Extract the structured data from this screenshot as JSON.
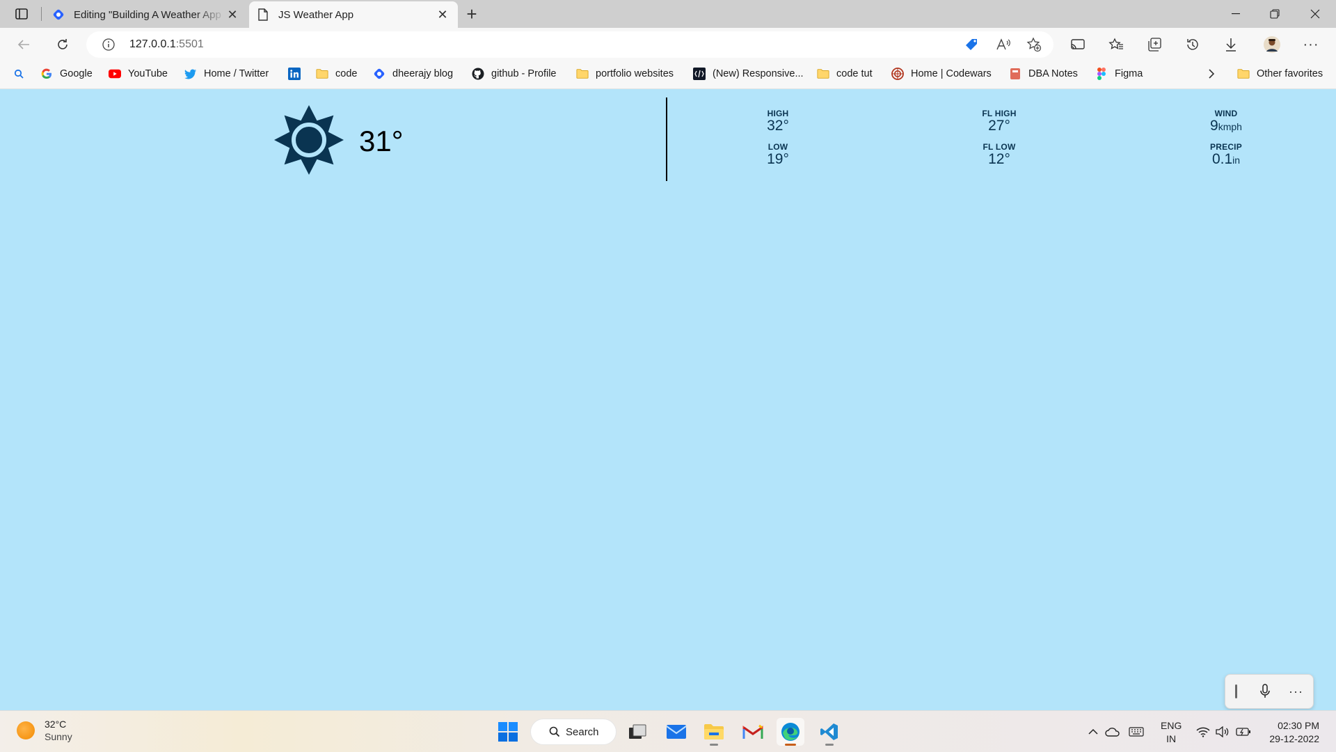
{
  "browser": {
    "tabs": [
      {
        "title": "Editing \"Building A Weather App",
        "favicon": "hashnode-icon"
      },
      {
        "title": "JS Weather App",
        "favicon": "page-icon"
      }
    ],
    "url": {
      "host": "127.0.0.1",
      "port": ":5501"
    }
  },
  "bookmarks": [
    {
      "label": "Google",
      "icon": "google-icon"
    },
    {
      "label": "YouTube",
      "icon": "youtube-icon"
    },
    {
      "label": "Home / Twitter",
      "icon": "twitter-icon"
    },
    {
      "label": "",
      "icon": "linkedin-icon"
    },
    {
      "label": "code",
      "icon": "folder-icon"
    },
    {
      "label": "dheerajy blog",
      "icon": "hashnode-icon"
    },
    {
      "label": "github - Profile",
      "icon": "github-icon"
    },
    {
      "label": "portfolio websites",
      "icon": "folder-icon"
    },
    {
      "label": "(New) Responsive...",
      "icon": "site-icon"
    },
    {
      "label": "code tut",
      "icon": "folder-icon"
    },
    {
      "label": "Home | Codewars",
      "icon": "codewars-icon"
    },
    {
      "label": "DBA Notes",
      "icon": "notes-icon"
    },
    {
      "label": "Figma",
      "icon": "figma-icon"
    },
    {
      "label": "Other favorites",
      "icon": "folder-icon"
    }
  ],
  "weather": {
    "current_temp": "31°",
    "icon": "sun-icon",
    "high": {
      "label": "HIGH",
      "value": "32°"
    },
    "low": {
      "label": "LOW",
      "value": "19°"
    },
    "fl_high": {
      "label": "FL HIGH",
      "value": "27°"
    },
    "fl_low": {
      "label": "FL LOW",
      "value": "12°"
    },
    "wind": {
      "label": "WIND",
      "value": "9",
      "unit": "kmph"
    },
    "precip": {
      "label": "PRECIP",
      "value": "0.1",
      "unit": "in"
    }
  },
  "taskbar": {
    "weather_temp": "32°C",
    "weather_desc": "Sunny",
    "search_label": "Search",
    "lang_top": "ENG",
    "lang_bottom": "IN",
    "time": "02:30 PM",
    "date": "29-12-2022"
  },
  "colors": {
    "page_bg": "#b3e4fa",
    "weather_icon": "#0a3451",
    "divider": "#000000"
  }
}
